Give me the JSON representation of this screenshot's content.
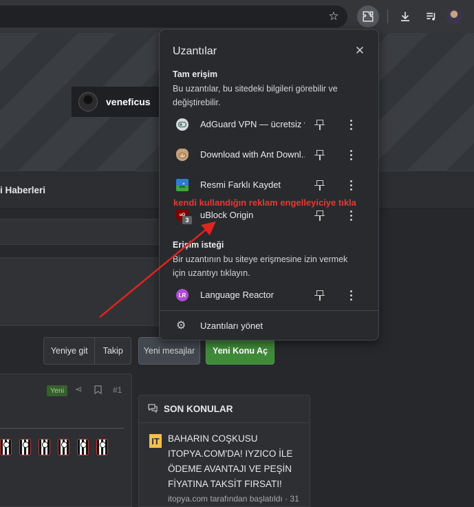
{
  "popup": {
    "title": "Uzantılar",
    "full_access": {
      "heading": "Tam erişim",
      "description": "Bu uzantılar, bu sitedeki bilgileri görebilir ve değiştirebilir."
    },
    "extensions_full": [
      {
        "name": "AdGuard VPN — ücretsiz v...",
        "icon": "adguard-vpn-icon"
      },
      {
        "name": "Download with Ant Downl...",
        "icon": "ant-downloader-icon"
      },
      {
        "name": "Resmi Farklı Kaydet",
        "icon": "save-image-as-icon"
      },
      {
        "name": "uBlock Origin",
        "icon": "ublock-origin-icon",
        "badge": "3"
      }
    ],
    "access_request": {
      "heading": "Erişim isteği",
      "description": "Bir uzantının bu siteye erişmesine izin vermek için uzantıyı tıklayın."
    },
    "extensions_request": [
      {
        "name": "Language Reactor",
        "icon": "language-reactor-icon"
      }
    ],
    "manage_label": "Uzantıları yönet"
  },
  "annotation": "kendi kullandığın reklam engelleyiciye tıkla",
  "page": {
    "username": "veneficus",
    "nav_label": "i Haberleri",
    "buttons": {
      "go_new": "Yeniye git",
      "follow": "Takip",
      "new_messages": "Yeni mesajlar",
      "new_topic": "Yeni Konu Aç"
    },
    "post": {
      "badge": "Yeni",
      "number": "#1"
    },
    "latest": {
      "heading": "SON KONULAR",
      "topic_title": "BAHARIN COŞKUSU ITOPYA.COM'DA! IYZICO İLE ÖDEME AVANTAJI VE PEŞİN FİYATINA TAKSİT FIRSATI!",
      "topic_meta": "itopya.com tarafından başlatıldı · 31"
    }
  },
  "colors": {
    "accent_red": "#e53935",
    "new_topic_green": "#3f8a39",
    "popup_bg": "#292a2d"
  }
}
